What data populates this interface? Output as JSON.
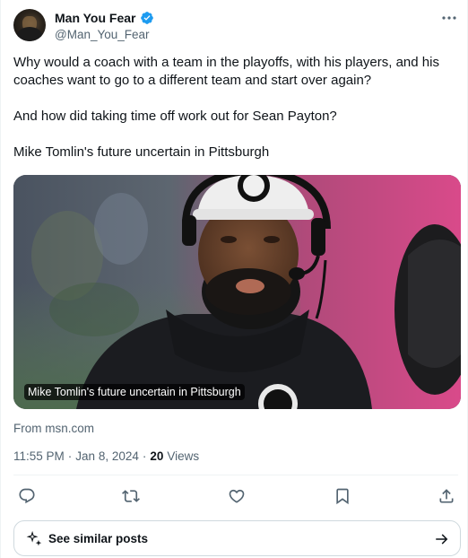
{
  "author": {
    "display_name": "Man You Fear",
    "handle": "@Man_You_Fear",
    "verified": true,
    "verified_color": "#1d9bf0"
  },
  "tweet": {
    "paragraphs": [
      "Why would a coach with a team in the playoffs, with his players, and his coaches want to go to a different team and start over again?",
      "And how did taking time off work out for Sean Payton?",
      "Mike Tomlin's future uncertain in Pittsburgh"
    ]
  },
  "card": {
    "caption": "Mike Tomlin's future uncertain in Pittsburgh",
    "source": "From msn.com"
  },
  "meta": {
    "time": "11:55 PM",
    "date": "Jan 8, 2024",
    "separator": "·",
    "views_count": "20",
    "views_label": "Views"
  },
  "actions": [
    {
      "name": "reply",
      "icon": "reply-icon"
    },
    {
      "name": "repost",
      "icon": "repost-icon"
    },
    {
      "name": "like",
      "icon": "heart-icon"
    },
    {
      "name": "bookmark",
      "icon": "bookmark-icon"
    },
    {
      "name": "share",
      "icon": "share-icon"
    }
  ],
  "similar_posts": {
    "label": "See similar posts"
  },
  "colors": {
    "text_primary": "#0f1419",
    "text_secondary": "#536471",
    "border": "#cfd9de",
    "divider": "#eff3f4"
  }
}
